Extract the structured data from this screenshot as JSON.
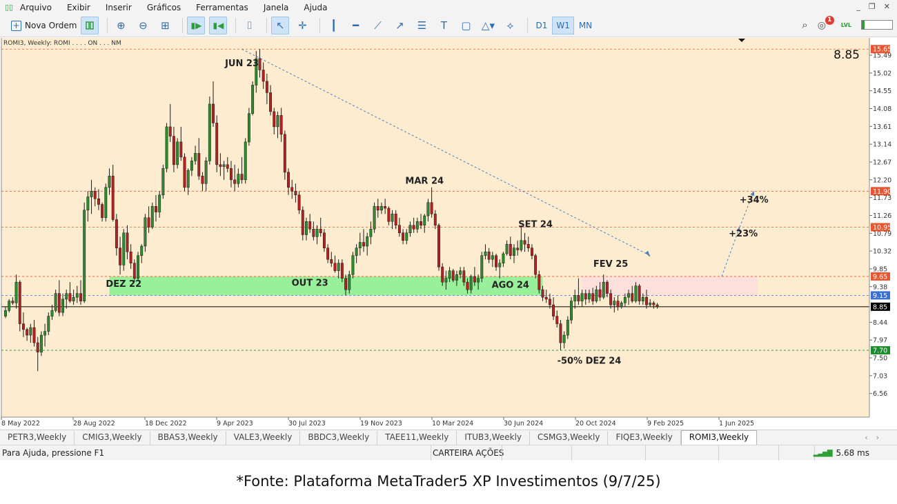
{
  "menu": [
    "Arquivo",
    "Exibir",
    "Inserir",
    "Gráficos",
    "Ferramentas",
    "Janela",
    "Ajuda"
  ],
  "toolbar": {
    "new_order_label": "Nova Ordem",
    "timeframes": [
      "D1",
      "W1",
      "MN"
    ],
    "active_timeframe": "W1",
    "notifications_count": "1",
    "level_fill": 0.08
  },
  "chart": {
    "header": "ROMI3, Weekly: ROMI . . . . ON . . . NM",
    "current_price": "8.85"
  },
  "chart_data": {
    "type": "candlestick",
    "symbol": "ROMI3",
    "timeframe": "Weekly",
    "ylim": [
      6.3,
      15.8
    ],
    "y_ticks": [
      "15.49",
      "15.02",
      "14.55",
      "14.08",
      "13.61",
      "13.14",
      "12.67",
      "12.20",
      "11.73",
      "11.26",
      "10.79",
      "10.32",
      "9.85",
      "9.38",
      "8.44",
      "7.97",
      "7.50",
      "7.03",
      "6.56"
    ],
    "x_ticks": [
      "8 May 2022",
      "28 Aug 2022",
      "18 Dec 2022",
      "9 Apr 2023",
      "30 Jul 2023",
      "19 Nov 2023",
      "10 Mar 2024",
      "30 Jun 2024",
      "20 Oct 2024",
      "9 Feb 2025",
      "1 Jun 2025"
    ],
    "price_labels": [
      {
        "text": "15.65",
        "value": 15.65,
        "color": "#e8552f"
      },
      {
        "text": "11.90",
        "value": 11.9,
        "color": "#e8552f"
      },
      {
        "text": "10.95",
        "value": 10.95,
        "color": "#e8552f"
      },
      {
        "text": "9.65",
        "value": 9.65,
        "color": "#e8552f"
      },
      {
        "text": "9.15",
        "value": 9.15,
        "color": "#3b6fd4"
      },
      {
        "text": "8.85",
        "value": 8.85,
        "color": "#000000"
      },
      {
        "text": "7.70",
        "value": 7.7,
        "color": "#1e8c2e"
      }
    ],
    "annotations": [
      {
        "text": "JUN 23",
        "week": 66,
        "value": 15.2
      },
      {
        "text": "DEZ 22",
        "week": 33,
        "value": 9.38
      },
      {
        "text": "OUT 23",
        "week": 85,
        "value": 9.4
      },
      {
        "text": "MAR 24",
        "week": 117,
        "value": 12.1
      },
      {
        "text": "SET 24",
        "week": 148,
        "value": 10.95
      },
      {
        "text": "AGO 24",
        "week": 141,
        "value": 9.35
      },
      {
        "text": "FEV 25",
        "week": 169,
        "value": 9.9
      },
      {
        "text": "-50% DEZ 24",
        "week": 163,
        "value": 7.35
      },
      {
        "text": "+23%",
        "week": 206,
        "value": 10.7
      },
      {
        "text": "+34%",
        "week": 209,
        "value": 11.6
      }
    ],
    "zones": [
      {
        "name": "support",
        "x": [
          29,
          150
        ],
        "y": [
          9.15,
          9.65
        ],
        "color": "#98f09a"
      },
      {
        "name": "resistance",
        "x": [
          161,
          210
        ],
        "y": [
          9.15,
          9.65
        ],
        "color": "#fde0dc"
      }
    ],
    "trendline": {
      "from": [
        66,
        15.65
      ],
      "to": [
        180,
        10.2
      ]
    },
    "projections": [
      {
        "from": [
          200,
          9.65
        ],
        "to": [
          205,
          10.95
        ]
      },
      {
        "from": [
          205,
          10.95
        ],
        "to": [
          209,
          11.9
        ]
      }
    ],
    "candles": [
      [
        8.6,
        8.85,
        8.55,
        8.75
      ],
      [
        8.75,
        9.05,
        8.7,
        9.0
      ],
      [
        9.0,
        9.1,
        8.9,
        8.95
      ],
      [
        8.95,
        9.7,
        8.8,
        9.5
      ],
      [
        9.5,
        9.55,
        8.2,
        8.4
      ],
      [
        8.4,
        8.7,
        8.05,
        8.25
      ],
      [
        8.25,
        8.3,
        7.95,
        8.1
      ],
      [
        8.1,
        8.4,
        7.9,
        8.3
      ],
      [
        8.3,
        8.5,
        7.8,
        7.9
      ],
      [
        7.9,
        8.05,
        7.15,
        7.65
      ],
      [
        7.65,
        8.2,
        7.55,
        8.1
      ],
      [
        8.1,
        8.4,
        7.8,
        8.2
      ],
      [
        8.2,
        8.7,
        8.1,
        8.6
      ],
      [
        8.6,
        8.9,
        8.5,
        8.75
      ],
      [
        8.75,
        9.3,
        8.7,
        9.2
      ],
      [
        9.2,
        9.55,
        8.6,
        8.7
      ],
      [
        8.7,
        9.2,
        8.6,
        9.05
      ],
      [
        9.05,
        9.3,
        8.8,
        9.2
      ],
      [
        9.2,
        9.5,
        8.95,
        9.0
      ],
      [
        9.0,
        9.3,
        8.9,
        9.1
      ],
      [
        9.1,
        9.4,
        8.95,
        9.2
      ],
      [
        9.2,
        9.55,
        8.9,
        9.0
      ],
      [
        9.0,
        11.6,
        8.95,
        11.4
      ],
      [
        11.4,
        11.9,
        11.1,
        11.75
      ],
      [
        11.75,
        12.2,
        11.3,
        11.9
      ],
      [
        11.9,
        12.0,
        11.5,
        11.7
      ],
      [
        11.7,
        11.95,
        11.4,
        11.55
      ],
      [
        11.55,
        11.6,
        11.1,
        11.2
      ],
      [
        11.2,
        12.1,
        11.1,
        12.0
      ],
      [
        12.0,
        12.5,
        11.8,
        12.3
      ],
      [
        12.3,
        12.6,
        11.1,
        11.15
      ],
      [
        11.15,
        11.3,
        10.2,
        10.4
      ],
      [
        10.4,
        10.7,
        9.7,
        9.95
      ],
      [
        9.95,
        10.9,
        9.8,
        10.8
      ],
      [
        10.8,
        11.0,
        10.1,
        10.3
      ],
      [
        10.3,
        10.5,
        9.85,
        10.0
      ],
      [
        10.0,
        10.1,
        9.5,
        9.6
      ],
      [
        9.6,
        10.3,
        9.55,
        10.2
      ],
      [
        10.2,
        10.5,
        10.0,
        10.45
      ],
      [
        10.45,
        11.3,
        10.3,
        11.2
      ],
      [
        11.2,
        11.5,
        10.8,
        10.95
      ],
      [
        10.95,
        11.6,
        10.9,
        11.5
      ],
      [
        11.5,
        11.8,
        11.1,
        11.35
      ],
      [
        11.35,
        11.9,
        11.2,
        11.8
      ],
      [
        11.8,
        12.6,
        11.7,
        12.5
      ],
      [
        12.5,
        13.7,
        12.4,
        13.6
      ],
      [
        13.6,
        14.2,
        13.2,
        13.35
      ],
      [
        13.35,
        13.6,
        12.4,
        12.6
      ],
      [
        12.6,
        13.3,
        12.5,
        13.2
      ],
      [
        13.2,
        13.6,
        12.7,
        12.8
      ],
      [
        12.8,
        12.9,
        11.9,
        12.0
      ],
      [
        12.0,
        12.5,
        11.8,
        12.45
      ],
      [
        12.45,
        12.8,
        12.3,
        12.7
      ],
      [
        12.7,
        13.1,
        12.6,
        12.9
      ],
      [
        12.9,
        13.3,
        12.2,
        12.3
      ],
      [
        12.3,
        12.4,
        11.9,
        12.1
      ],
      [
        12.1,
        12.8,
        11.9,
        12.7
      ],
      [
        12.7,
        14.4,
        12.6,
        14.2
      ],
      [
        14.2,
        14.8,
        13.6,
        13.7
      ],
      [
        13.7,
        13.9,
        12.4,
        12.6
      ],
      [
        12.6,
        12.9,
        12.3,
        12.55
      ],
      [
        12.55,
        12.7,
        12.2,
        12.6
      ],
      [
        12.6,
        12.8,
        12.4,
        12.5
      ],
      [
        12.5,
        12.7,
        12.0,
        12.2
      ],
      [
        12.2,
        12.6,
        11.9,
        12.1
      ],
      [
        12.1,
        12.5,
        12.0,
        12.35
      ],
      [
        12.35,
        12.8,
        12.1,
        12.2
      ],
      [
        12.2,
        13.3,
        12.1,
        13.2
      ],
      [
        13.2,
        14.1,
        13.1,
        13.95
      ],
      [
        13.95,
        14.8,
        13.9,
        14.7
      ],
      [
        14.7,
        15.6,
        14.5,
        15.4
      ],
      [
        15.4,
        15.65,
        14.9,
        15.1
      ],
      [
        15.1,
        15.3,
        14.6,
        14.8
      ],
      [
        14.8,
        15.0,
        14.2,
        14.5
      ],
      [
        14.5,
        14.7,
        13.9,
        14.0
      ],
      [
        14.0,
        14.1,
        13.4,
        13.6
      ],
      [
        13.6,
        14.0,
        13.3,
        13.9
      ],
      [
        13.9,
        14.1,
        13.2,
        13.4
      ],
      [
        13.4,
        13.5,
        12.2,
        12.4
      ],
      [
        12.4,
        12.5,
        11.8,
        12.0
      ],
      [
        12.0,
        12.2,
        11.7,
        11.9
      ],
      [
        11.9,
        12.1,
        11.6,
        11.8
      ],
      [
        11.8,
        11.9,
        11.3,
        11.4
      ],
      [
        11.4,
        11.5,
        10.6,
        10.75
      ],
      [
        10.75,
        11.2,
        10.6,
        11.1
      ],
      [
        11.1,
        11.3,
        10.8,
        10.9
      ],
      [
        10.9,
        11.1,
        10.6,
        10.7
      ],
      [
        10.7,
        11.0,
        10.5,
        10.9
      ],
      [
        10.9,
        11.2,
        10.7,
        10.8
      ],
      [
        10.8,
        10.9,
        10.3,
        10.4
      ],
      [
        10.4,
        10.5,
        10.0,
        10.1
      ],
      [
        10.1,
        10.3,
        9.9,
        10.0
      ],
      [
        10.0,
        10.2,
        9.75,
        9.8
      ],
      [
        9.8,
        10.1,
        9.6,
        10.0
      ],
      [
        10.0,
        10.1,
        9.5,
        9.6
      ],
      [
        9.6,
        9.7,
        9.15,
        9.3
      ],
      [
        9.3,
        9.8,
        9.2,
        9.7
      ],
      [
        9.7,
        10.3,
        9.6,
        10.2
      ],
      [
        10.2,
        10.5,
        10.0,
        10.4
      ],
      [
        10.4,
        10.8,
        10.2,
        10.55
      ],
      [
        10.55,
        10.9,
        10.3,
        10.45
      ],
      [
        10.45,
        10.8,
        10.2,
        10.7
      ],
      [
        10.7,
        11.1,
        10.5,
        10.9
      ],
      [
        10.9,
        11.6,
        10.8,
        11.5
      ],
      [
        11.5,
        11.7,
        11.2,
        11.4
      ],
      [
        11.4,
        11.6,
        11.3,
        11.5
      ],
      [
        11.5,
        11.7,
        11.3,
        11.45
      ],
      [
        11.45,
        11.5,
        11.0,
        11.1
      ],
      [
        11.1,
        11.4,
        10.9,
        11.3
      ],
      [
        11.3,
        11.4,
        10.9,
        11.0
      ],
      [
        11.0,
        11.2,
        10.7,
        10.8
      ],
      [
        10.8,
        10.9,
        10.5,
        10.6
      ],
      [
        10.6,
        10.9,
        10.5,
        10.8
      ],
      [
        10.8,
        11.1,
        10.7,
        11.0
      ],
      [
        11.0,
        11.2,
        10.8,
        10.9
      ],
      [
        10.9,
        11.2,
        10.8,
        11.1
      ],
      [
        11.1,
        11.3,
        10.9,
        11.0
      ],
      [
        11.0,
        11.3,
        10.8,
        11.25
      ],
      [
        11.25,
        11.7,
        11.1,
        11.6
      ],
      [
        11.6,
        12.0,
        11.2,
        11.3
      ],
      [
        11.3,
        11.4,
        10.9,
        11.0
      ],
      [
        11.0,
        11.05,
        9.8,
        9.9
      ],
      [
        9.9,
        10.0,
        9.4,
        9.5
      ],
      [
        9.5,
        9.8,
        9.3,
        9.6
      ],
      [
        9.6,
        9.9,
        9.5,
        9.8
      ],
      [
        9.8,
        9.85,
        9.5,
        9.55
      ],
      [
        9.55,
        9.8,
        9.4,
        9.7
      ],
      [
        9.7,
        9.9,
        9.6,
        9.8
      ],
      [
        9.8,
        9.9,
        9.4,
        9.5
      ],
      [
        9.5,
        9.6,
        9.2,
        9.3
      ],
      [
        9.3,
        9.7,
        9.2,
        9.65
      ],
      [
        9.65,
        9.9,
        9.4,
        9.5
      ],
      [
        9.5,
        9.7,
        9.3,
        9.6
      ],
      [
        9.6,
        10.3,
        9.5,
        10.2
      ],
      [
        10.2,
        10.5,
        10.1,
        10.3
      ],
      [
        10.3,
        10.4,
        10.0,
        10.1
      ],
      [
        10.1,
        10.3,
        9.9,
        10.2
      ],
      [
        10.2,
        10.25,
        9.8,
        9.9
      ],
      [
        9.9,
        10.1,
        9.6,
        10.0
      ],
      [
        10.0,
        10.3,
        9.9,
        10.25
      ],
      [
        10.25,
        10.6,
        10.2,
        10.5
      ],
      [
        10.5,
        10.7,
        10.1,
        10.2
      ],
      [
        10.2,
        10.5,
        10.0,
        10.4
      ],
      [
        10.4,
        10.6,
        10.2,
        10.35
      ],
      [
        10.35,
        11.0,
        10.3,
        10.6
      ],
      [
        10.6,
        10.8,
        10.3,
        10.5
      ],
      [
        10.5,
        10.7,
        10.3,
        10.4
      ],
      [
        10.4,
        10.5,
        10.1,
        10.2
      ],
      [
        10.2,
        10.25,
        9.6,
        9.7
      ],
      [
        9.7,
        9.8,
        9.2,
        9.3
      ],
      [
        9.3,
        9.4,
        9.0,
        9.1
      ],
      [
        9.1,
        9.3,
        8.95,
        9.05
      ],
      [
        9.05,
        9.2,
        8.8,
        8.9
      ],
      [
        8.9,
        9.1,
        8.5,
        8.6
      ],
      [
        8.6,
        8.75,
        8.3,
        8.4
      ],
      [
        8.4,
        8.5,
        7.7,
        7.9
      ],
      [
        7.9,
        8.2,
        7.75,
        8.1
      ],
      [
        8.1,
        8.6,
        8.0,
        8.5
      ],
      [
        8.5,
        9.1,
        8.4,
        9.0
      ],
      [
        9.0,
        9.3,
        8.8,
        9.15
      ],
      [
        9.15,
        9.6,
        8.9,
        9.0
      ],
      [
        9.0,
        9.3,
        8.85,
        9.2
      ],
      [
        9.2,
        9.3,
        8.9,
        9.05
      ],
      [
        9.05,
        9.3,
        8.95,
        9.2
      ],
      [
        9.2,
        9.35,
        8.9,
        9.0
      ],
      [
        9.0,
        9.4,
        8.95,
        9.3
      ],
      [
        9.3,
        9.5,
        9.0,
        9.1
      ],
      [
        9.1,
        9.7,
        9.05,
        9.5
      ],
      [
        9.5,
        9.55,
        9.1,
        9.2
      ],
      [
        9.2,
        9.3,
        8.8,
        8.9
      ],
      [
        8.9,
        9.1,
        8.7,
        9.0
      ],
      [
        9.0,
        9.15,
        8.75,
        8.85
      ],
      [
        8.85,
        9.0,
        8.8,
        8.95
      ],
      [
        8.95,
        9.2,
        8.85,
        9.1
      ],
      [
        9.1,
        9.3,
        8.9,
        9.2
      ],
      [
        9.2,
        9.4,
        8.95,
        9.0
      ],
      [
        9.0,
        9.5,
        8.95,
        9.4
      ],
      [
        9.4,
        9.45,
        8.9,
        9.0
      ],
      [
        9.0,
        9.2,
        8.9,
        9.1
      ],
      [
        9.1,
        9.3,
        8.8,
        8.9
      ],
      [
        8.9,
        9.05,
        8.85,
        8.95
      ],
      [
        8.95,
        9.0,
        8.8,
        8.9
      ],
      [
        8.9,
        8.95,
        8.8,
        8.85
      ]
    ]
  },
  "tabs": [
    "PETR3,Weekly",
    "CMIG3,Weekly",
    "BBAS3,Weekly",
    "VALE3,Weekly",
    "BBDC3,Weekly",
    "TAEE11,Weekly",
    "ITUB3,Weekly",
    "CSMG3,Weekly",
    "FIQE3,Weekly",
    "ROMI3,Weekly"
  ],
  "active_tab": "ROMI3,Weekly",
  "status": {
    "help": "Para Ajuda, pressione F1",
    "profile": "CARTEIRA AÇÕES",
    "ping": "5.68 ms"
  },
  "caption": "*Fonte: Plataforma MetaTrader5 XP Investimentos (9/7/25)"
}
